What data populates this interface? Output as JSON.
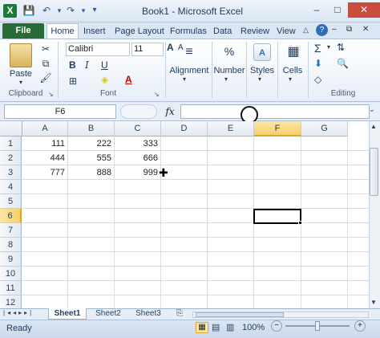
{
  "window": {
    "title": "Book1 - Microsoft Excel",
    "app_icon": "X",
    "minimize": "–",
    "maximize": "□",
    "close": "✕"
  },
  "quick_access": {
    "save": "💾",
    "undo": "↶",
    "redo": "↷",
    "customize": "▾"
  },
  "tabs": {
    "file": "File",
    "home": "Home",
    "insert": "Insert",
    "page_layout": "Page Layout",
    "formulas": "Formulas",
    "data": "Data",
    "review": "Review",
    "view": "View"
  },
  "ribbon": {
    "paste_label": "Paste",
    "font_name": "Calibri",
    "font_size": "11",
    "bold": "B",
    "italic": "I",
    "underline": "U",
    "groups": {
      "clipboard": "Clipboard",
      "font": "Font",
      "editing": "Editing"
    },
    "alignment_label": "Alignment",
    "number_label": "Number",
    "number_symbol": "%",
    "styles_label": "Styles",
    "cells_label": "Cells",
    "grow_font": "A",
    "shrink_font": "A"
  },
  "formula_bar": {
    "name_box": "F6",
    "fx": "fx",
    "formula": ""
  },
  "columns": [
    "A",
    "B",
    "C",
    "D",
    "E",
    "F",
    "G"
  ],
  "rows": [
    "1",
    "2",
    "3",
    "4",
    "5",
    "6",
    "7",
    "8",
    "9",
    "10",
    "11",
    "12"
  ],
  "cells": [
    [
      "111",
      "222",
      "333"
    ],
    [
      "444",
      "555",
      "666"
    ],
    [
      "777",
      "888",
      "999"
    ]
  ],
  "selected_cell": "F6",
  "sheet_tabs": [
    "Sheet1",
    "Sheet2",
    "Sheet3"
  ],
  "status": {
    "ready": "Ready",
    "zoom": "100%",
    "zoom_out": "−",
    "zoom_in": "+"
  },
  "colors": {
    "file_tab": "#2a6a36",
    "selection": "#f6cf6a",
    "close_btn": "#c94c3c"
  }
}
